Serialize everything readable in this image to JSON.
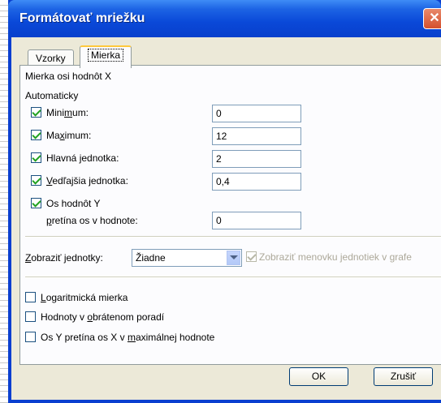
{
  "window": {
    "title": "Formátovať mriežku",
    "close_label": "✕"
  },
  "tabs": [
    {
      "label": "Vzorky"
    },
    {
      "label": "Mierka"
    }
  ],
  "scale": {
    "heading": "Mierka osi hodnôt X",
    "auto_label": "Automaticky",
    "minimum": {
      "label_pre": "Mini",
      "label_u": "m",
      "label_post": "um:",
      "checked": true,
      "value": "0"
    },
    "maximum": {
      "label_pre": "Ma",
      "label_u": "x",
      "label_post": "imum:",
      "checked": true,
      "value": "12"
    },
    "major": {
      "label_pre": "Hlavná ",
      "label_u": "j",
      "label_post": "ednotka:",
      "checked": true,
      "value": "2"
    },
    "minor": {
      "label_pre": "",
      "label_u": "V",
      "label_post": "edľajšia jednotka:",
      "checked": true,
      "value": "0,4"
    },
    "cross": {
      "label": "Os hodnôt Y",
      "label2_u": "p",
      "label2_post": "retína os v hodnote:",
      "checked": true,
      "value": "0"
    }
  },
  "units": {
    "label_u": "Z",
    "label_post": "obraziť jednotky:",
    "selected": "Žiadne",
    "show_label": "Zobraziť menovku jednotiek v grafe"
  },
  "options": {
    "log": {
      "label_u": "L",
      "label_post": "ogaritmická mierka"
    },
    "reverse": {
      "label_pre": "Hodnoty v ",
      "label_u": "o",
      "label_post": "brátenom poradí"
    },
    "crossmax": {
      "label_pre": "Os Y pretína os X v ",
      "label_u": "m",
      "label_post": "aximálnej hodnote"
    }
  },
  "buttons": {
    "ok": "OK",
    "cancel": "Zrušiť"
  }
}
